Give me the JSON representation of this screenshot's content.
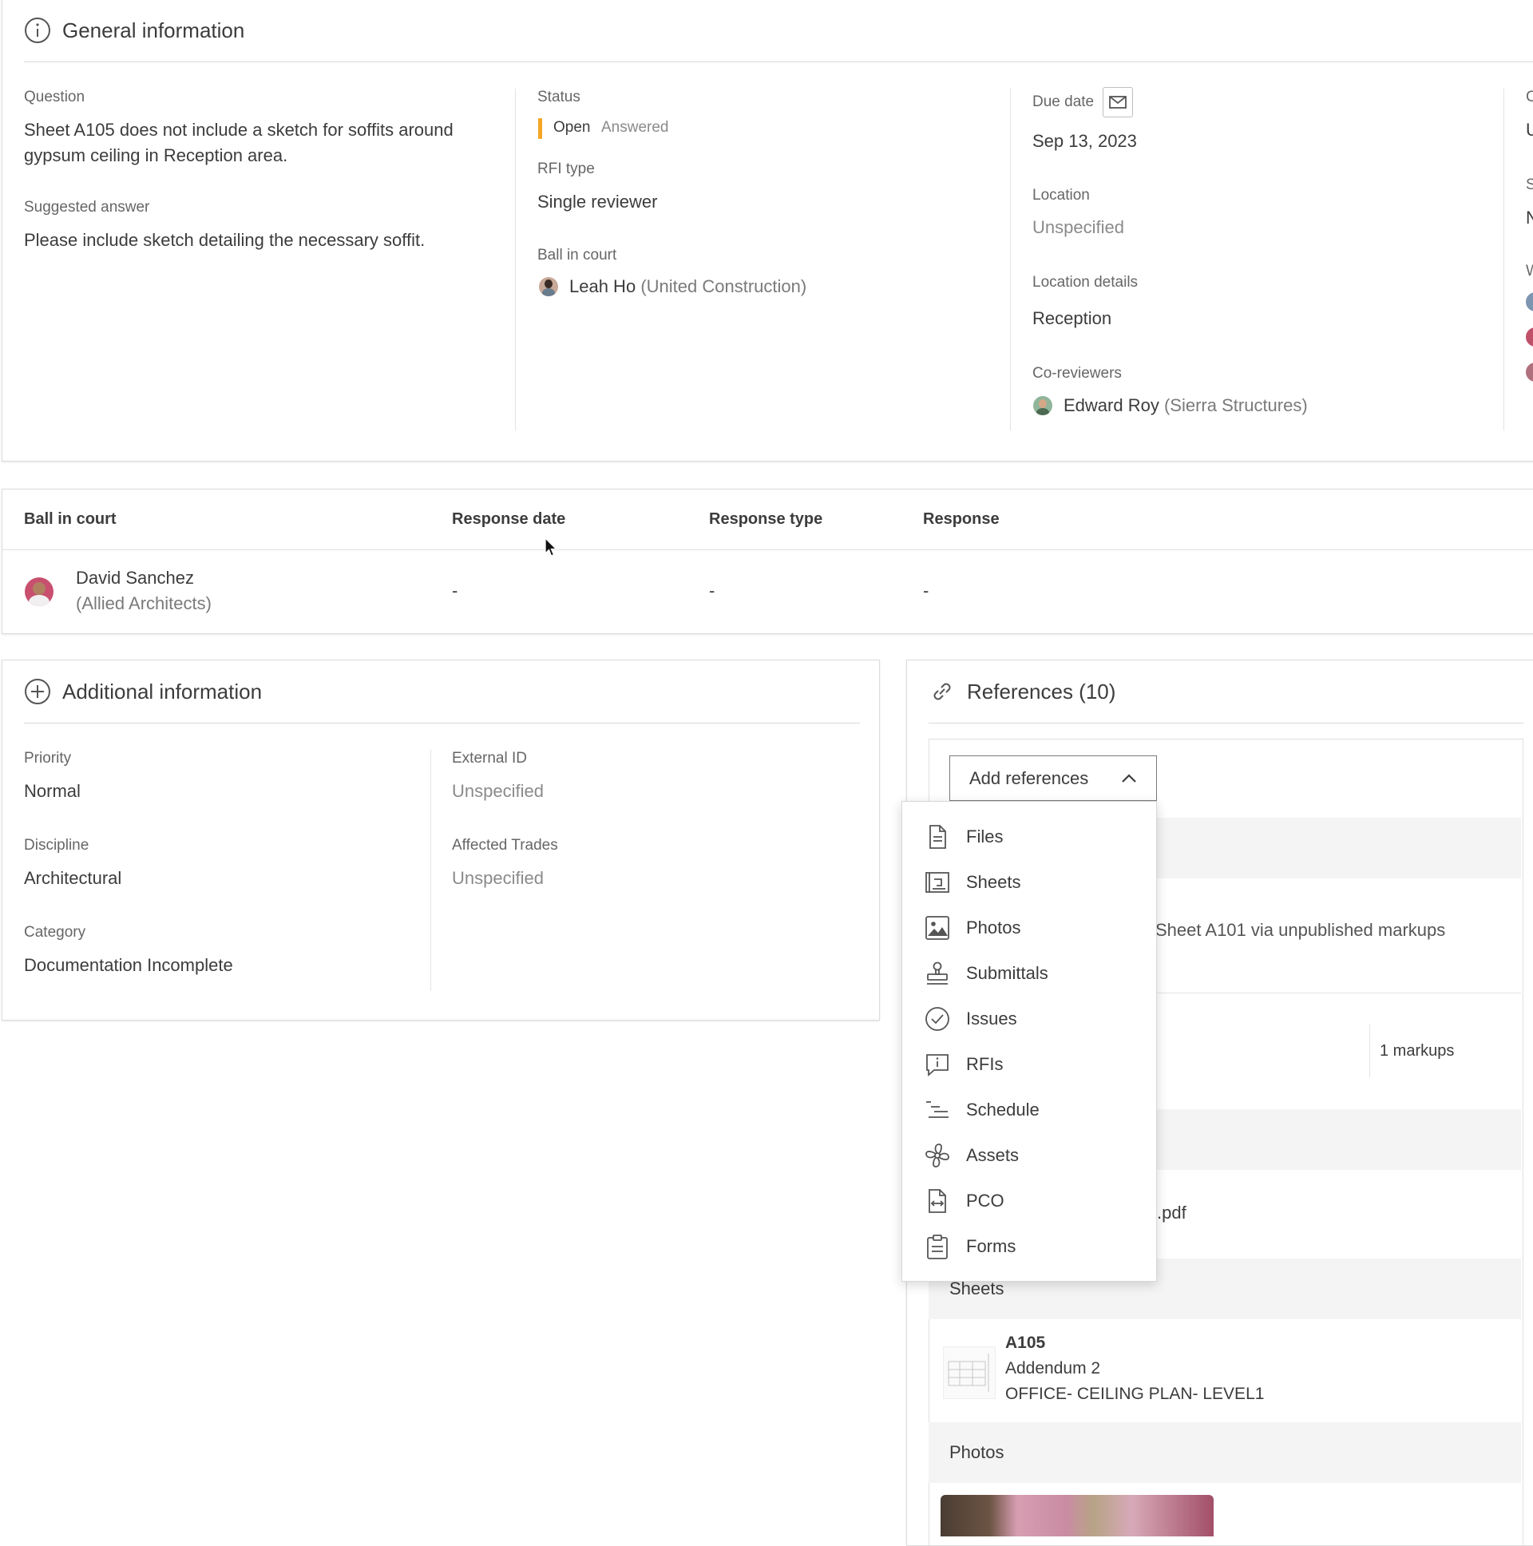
{
  "general": {
    "title": "General information",
    "question_label": "Question",
    "question": "Sheet A105 does not include a sketch for soffits around gypsum ceiling in Reception area.",
    "suggested_label": "Suggested answer",
    "suggested": "Please include sketch detailing the necessary soffit.",
    "status_label": "Status",
    "status_open": "Open",
    "status_answered": "Answered",
    "status_color": "#f5a623",
    "rfi_type_label": "RFI type",
    "rfi_type": "Single reviewer",
    "bic_label": "Ball in court",
    "bic_name": "Leah Ho",
    "bic_org": "(United Construction)",
    "due_label": "Due date",
    "due": "Sep 13, 2023",
    "location_label": "Location",
    "location": "Unspecified",
    "location_details_label": "Location details",
    "location_details": "Reception",
    "coreviewers_label": "Co-reviewers",
    "coreviewer_name": "Edward Roy",
    "coreviewer_org": "(Sierra Structures)",
    "cut_col": {
      "l1": "C",
      "v1": "U",
      "l2": "S",
      "v2": "N",
      "l3": "W"
    }
  },
  "responses": {
    "headers": [
      "Ball in court",
      "Response date",
      "Response type",
      "Response"
    ],
    "row": {
      "name": "David Sanchez",
      "org": "(Allied Architects)",
      "date": "-",
      "type": "-",
      "response": "-"
    }
  },
  "additional": {
    "title": "Additional information",
    "priority_label": "Priority",
    "priority": "Normal",
    "discipline_label": "Discipline",
    "discipline": "Architectural",
    "category_label": "Category",
    "category": "Documentation Incomplete",
    "external_label": "External ID",
    "external": "Unspecified",
    "trades_label": "Affected Trades",
    "trades": "Unspecified"
  },
  "references": {
    "title": "References (10)",
    "add_button": "Add references",
    "bg_markup_text": "Sheet A101 via unpublished markups",
    "markups": "1 markups",
    "pdf_tail": ".pdf",
    "sheets_group": "Sheets",
    "sheet_number": "A105",
    "sheet_version": "Addendum 2",
    "sheet_name": "OFFICE- CEILING PLAN- LEVEL1",
    "photos_group": "Photos",
    "menu": [
      {
        "label": "Files",
        "icon": "file-icon"
      },
      {
        "label": "Sheets",
        "icon": "sheet-icon"
      },
      {
        "label": "Photos",
        "icon": "photo-icon"
      },
      {
        "label": "Submittals",
        "icon": "stamp-icon"
      },
      {
        "label": "Issues",
        "icon": "check-circle-icon"
      },
      {
        "label": "RFIs",
        "icon": "rfi-icon"
      },
      {
        "label": "Schedule",
        "icon": "schedule-icon"
      },
      {
        "label": "Assets",
        "icon": "fan-icon"
      },
      {
        "label": "PCO",
        "icon": "pco-icon"
      },
      {
        "label": "Forms",
        "icon": "clipboard-icon"
      }
    ]
  }
}
